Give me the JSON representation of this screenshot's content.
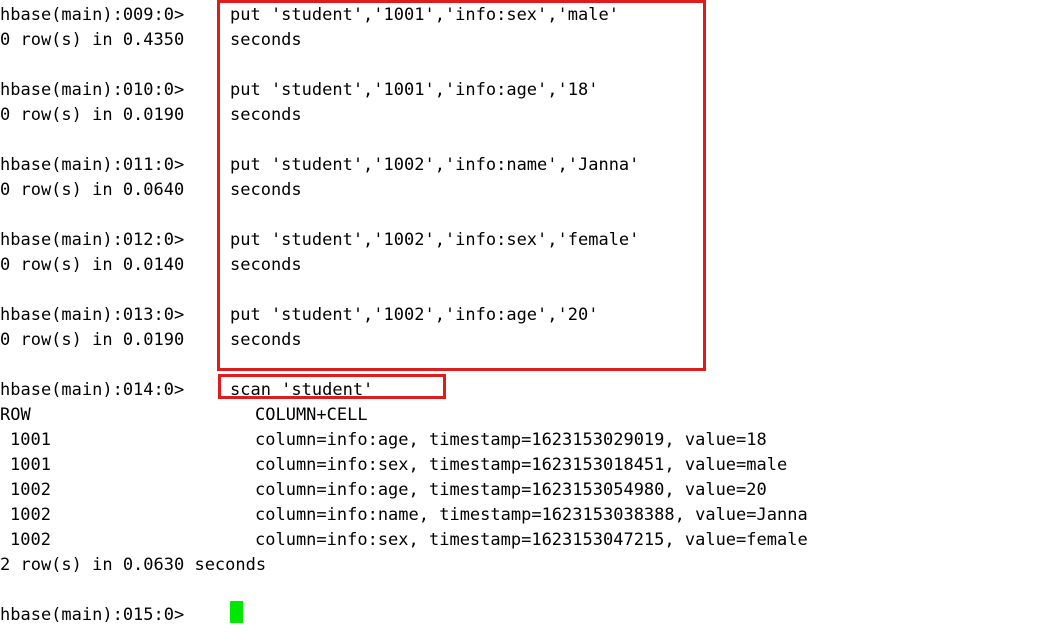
{
  "terminal": {
    "shell_name": "hbase shell",
    "background_color": "#ffffff",
    "text_color": "#000000",
    "cursor_color": "#00e800",
    "annotation_color": "#e01b1b"
  },
  "left_column": {
    "lines": [
      "hbase(main):009:0>",
      "0 row(s) in 0.4350",
      "",
      "hbase(main):010:0>",
      "0 row(s) in 0.0190",
      "",
      "hbase(main):011:0>",
      "0 row(s) in 0.0640",
      "",
      "hbase(main):012:0>",
      "0 row(s) in 0.0140",
      "",
      "hbase(main):013:0>",
      "0 row(s) in 0.0190",
      "",
      "hbase(main):014:0>"
    ]
  },
  "boxed_commands": {
    "label": "put commands highlighted",
    "entries": [
      {
        "command": "put 'student','1001','info:sex','male'",
        "result_suffix": "seconds"
      },
      {
        "command": "put 'student','1001','info:age','18'",
        "result_suffix": "seconds"
      },
      {
        "command": "put 'student','1002','info:name','Janna'",
        "result_suffix": "seconds"
      },
      {
        "command": "put 'student','1002','info:sex','female'",
        "result_suffix": "seconds"
      },
      {
        "command": "put 'student','1002','info:age','20'",
        "result_suffix": "seconds"
      }
    ]
  },
  "scan_command": {
    "prompt": "hbase(main):014:0>",
    "command": "scan 'student'"
  },
  "scan_output": {
    "headers": {
      "row": "ROW",
      "column_cell": "COLUMN+CELL"
    },
    "rows": [
      {
        "row_key": "1001",
        "cell": "column=info:age, timestamp=1623153029019, value=18"
      },
      {
        "row_key": "1001",
        "cell": "column=info:sex, timestamp=1623153018451, value=male"
      },
      {
        "row_key": "1002",
        "cell": "column=info:age, timestamp=1623153054980, value=20"
      },
      {
        "row_key": "1002",
        "cell": "column=info:name, timestamp=1623153038388, value=Janna"
      },
      {
        "row_key": "1002",
        "cell": "column=info:sex, timestamp=1623153047215, value=female"
      }
    ],
    "summary": "2 row(s) in 0.0630 seconds"
  },
  "final_prompt": {
    "prompt": "hbase(main):015:0>",
    "input_value": ""
  }
}
